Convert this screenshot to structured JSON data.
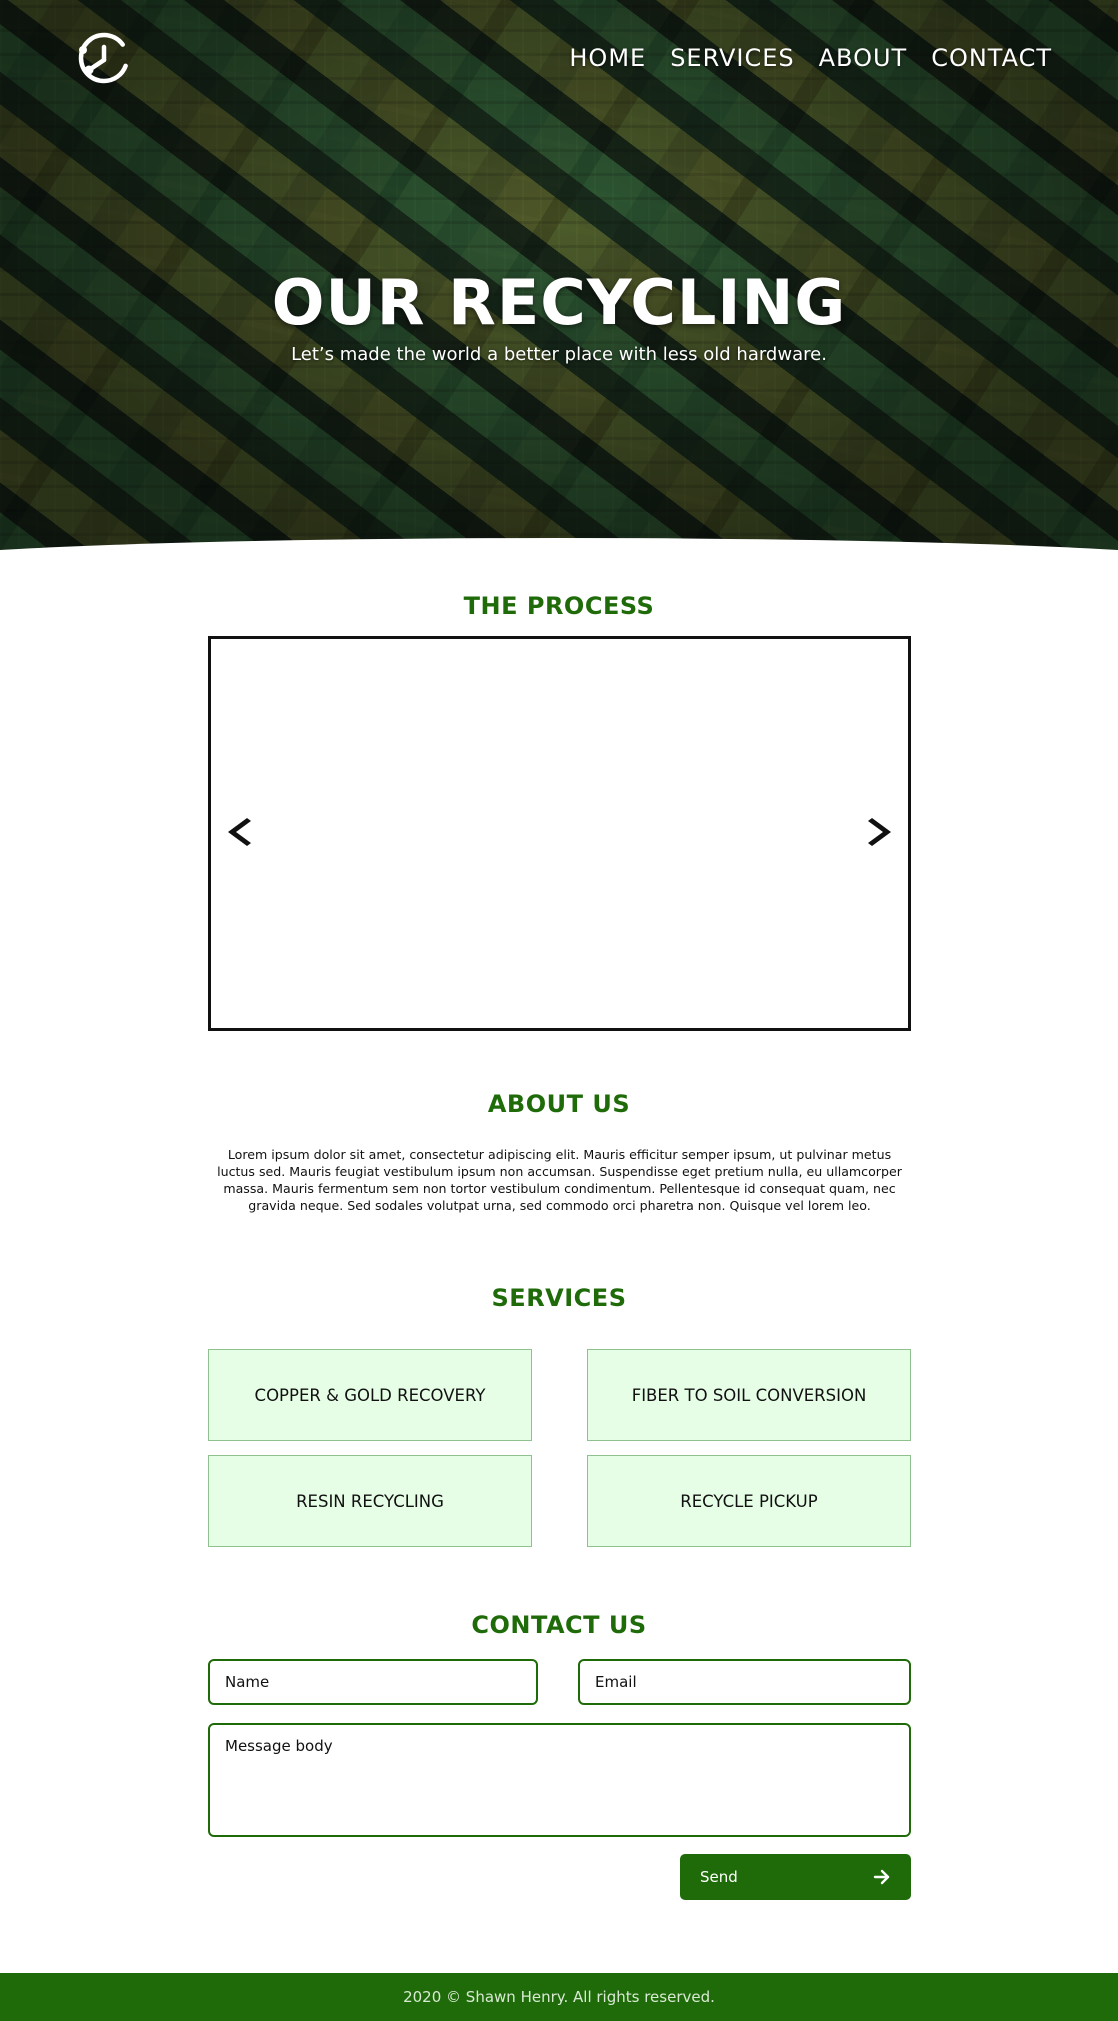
{
  "nav": {
    "items": [
      "HOME",
      "SERVICES",
      "ABOUT",
      "CONTACT"
    ]
  },
  "hero": {
    "title": "OUR RECYCLING",
    "subtitle": "Let’s made the world a better place with less old hardware."
  },
  "process": {
    "title": "THE PROCESS",
    "prev_icon": "chevron-left-icon",
    "next_icon": "chevron-right-icon"
  },
  "about": {
    "title": "ABOUT US",
    "body": "Lorem ipsum dolor sit amet, consectetur adipiscing elit. Mauris efficitur semper ipsum, ut pulvinar metus luctus sed. Mauris feugiat vestibulum ipsum non accumsan. Suspendisse eget pretium nulla, eu ullamcorper massa. Mauris fermentum sem non tortor vestibulum condimentum. Pellentesque id consequat quam, nec gravida neque. Sed sodales volutpat urna, sed commodo orci pharetra non. Quisque vel lorem leo."
  },
  "services": {
    "title": "SERVICES",
    "items": [
      "COPPER & GOLD RECOVERY",
      "FIBER TO SOIL CONVERSION",
      "RESIN RECYCLING",
      "RECYCLE PICKUP"
    ]
  },
  "contact": {
    "title": "CONTACT US",
    "name_placeholder": "Name",
    "email_placeholder": "Email",
    "message_placeholder": "Message body",
    "send_label": "Send",
    "send_icon": "arrow-right-icon"
  },
  "footer": {
    "text": "2020 © Shawn Henry. All rights reserved."
  },
  "colors": {
    "accent": "#1f6b0a",
    "service_card_bg": "#e6fde6",
    "service_card_border": "#8fc18f"
  }
}
